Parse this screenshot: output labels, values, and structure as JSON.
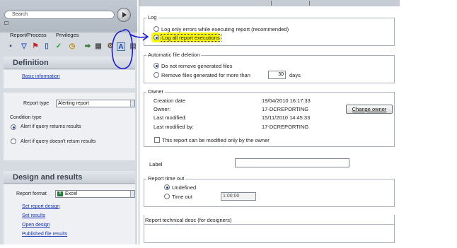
{
  "search": {
    "placeholder": "Search"
  },
  "tabs": [
    "Report/Process",
    "Privileges"
  ],
  "toolbar_icons": [
    "document-icon",
    "filter-icon",
    "flag-icon",
    "database-icon",
    "checkmark-icon",
    "clock-icon",
    "schedule-icon",
    "table-icon",
    "settings-icon",
    "text-icon",
    "grid-icon"
  ],
  "toolbar_text_icon_glyph": "A",
  "definition": {
    "title": "Definition",
    "basic_info": "Basic information",
    "report_type_label": "Report type",
    "report_type_value": "Alerting report",
    "condition_type_label": "Condition type",
    "condition_options": [
      "Alert if query returns results",
      "Alert if query doesn't return results"
    ],
    "condition_selected": 0
  },
  "design": {
    "title": "Design and results",
    "report_format_label": "Report format",
    "report_format_value": "Excel",
    "links": [
      "Set report design",
      "Set results",
      "Open design",
      "Published file results"
    ]
  },
  "log": {
    "title": "Log",
    "options": [
      "Log only errors while executing report (recommended)",
      "Log all report executions"
    ],
    "selected": 1
  },
  "auto_delete": {
    "title": "Automatic file deletion",
    "options": [
      "Do not remove generated files",
      "Remove files generated for more than"
    ],
    "selected": 0,
    "days_value": "30",
    "days_label": "days"
  },
  "owner": {
    "title": "Owner",
    "rows": [
      {
        "label": "Creation date",
        "value": "19/04/2010 16:17:33"
      },
      {
        "label": "Owner:",
        "value": "17-DCREPORTING"
      },
      {
        "label": "Last modified:",
        "value": "15/11/2010 14:45:33"
      },
      {
        "label": "Last modified by:",
        "value": "17-DCREPORTING"
      }
    ],
    "change_owner": "Change owner",
    "only_owner_label": "This report can be modified only by the owner"
  },
  "label": {
    "title": "Label",
    "value": ""
  },
  "timeout": {
    "title": "Report time out",
    "options": [
      "Undefined",
      "Time out"
    ],
    "selected": 0,
    "time_value": "1:00:00"
  },
  "tech_desc": {
    "title": "Report technical desc (for designers)"
  },
  "colors": {
    "highlight": "#f7f700",
    "annotation": "#1b1bd6",
    "link": "#1a37b5"
  }
}
